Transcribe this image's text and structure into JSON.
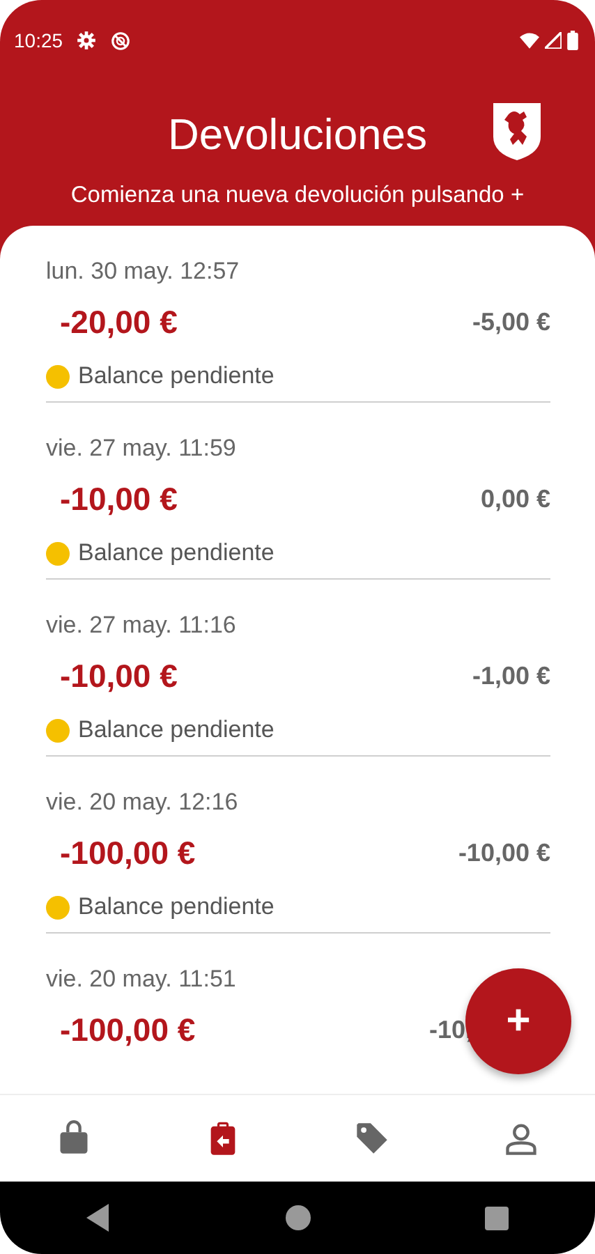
{
  "status_bar": {
    "time": "10:25"
  },
  "header": {
    "title": "Devoluciones",
    "subtitle": "Comienza una nueva devolución pulsando +"
  },
  "returns": [
    {
      "date": "lun. 30 may. 12:57",
      "amount": "-20,00 €",
      "balance": "-5,00 €",
      "status": {
        "label": "Balance pendiente",
        "color": "#f5c000"
      }
    },
    {
      "date": "vie. 27 may. 11:59",
      "amount": "-10,00 €",
      "balance": "0,00 €",
      "status": {
        "label": "Balance pendiente",
        "color": "#f5c000"
      }
    },
    {
      "date": "vie. 27 may. 11:16",
      "amount": "-10,00 €",
      "balance": "-1,00 €",
      "status": {
        "label": "Balance pendiente",
        "color": "#f5c000"
      }
    },
    {
      "date": "vie. 20 may. 12:16",
      "amount": "-100,00 €",
      "balance": "-10,00 €",
      "status": {
        "label": "Balance pendiente",
        "color": "#f5c000"
      }
    },
    {
      "date": "vie. 20 may. 11:51",
      "amount": "-100,00 €",
      "balance": "-10,"
    }
  ],
  "fab": {
    "label": "+"
  },
  "bottom_nav": [
    {
      "kind": "shop",
      "selected": false
    },
    {
      "kind": "returns",
      "selected": true
    },
    {
      "kind": "tag",
      "selected": false
    },
    {
      "kind": "profile",
      "selected": false
    }
  ]
}
